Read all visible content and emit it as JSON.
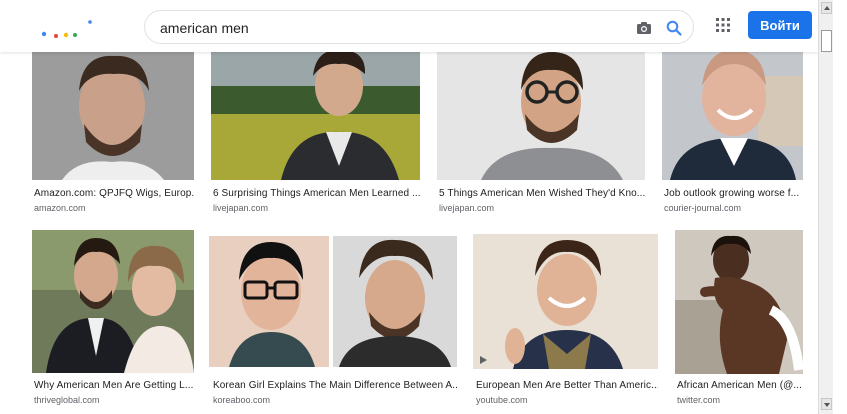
{
  "search": {
    "query": "american men"
  },
  "header": {
    "login_label": "Войти"
  },
  "results": [
    {
      "caption": "Amazon.com: QPJFQ Wigs, Europ...",
      "domain": "amazon.com"
    },
    {
      "caption": "6 Surprising Things American Men Learned ...",
      "domain": "livejapan.com"
    },
    {
      "caption": "5 Things American Men Wished They'd Kno...",
      "domain": "livejapan.com"
    },
    {
      "caption": "Job outlook growing worse f...",
      "domain": "courier-journal.com"
    },
    {
      "caption": "Why American Men Are Getting L...",
      "domain": "thriveglobal.com"
    },
    {
      "caption": "Korean Girl Explains The Main Difference Between A...",
      "domain": "koreaboo.com"
    },
    {
      "caption": "European Men Are Better Than Americ...",
      "domain": "youtube.com"
    },
    {
      "caption": "African American Men (@...",
      "domain": "twitter.com"
    }
  ],
  "colors": {
    "accent": "#1a73e8",
    "search_icon": "#4285f4"
  },
  "icons": [
    "camera-icon",
    "search-icon",
    "apps-icon",
    "play-icon"
  ]
}
